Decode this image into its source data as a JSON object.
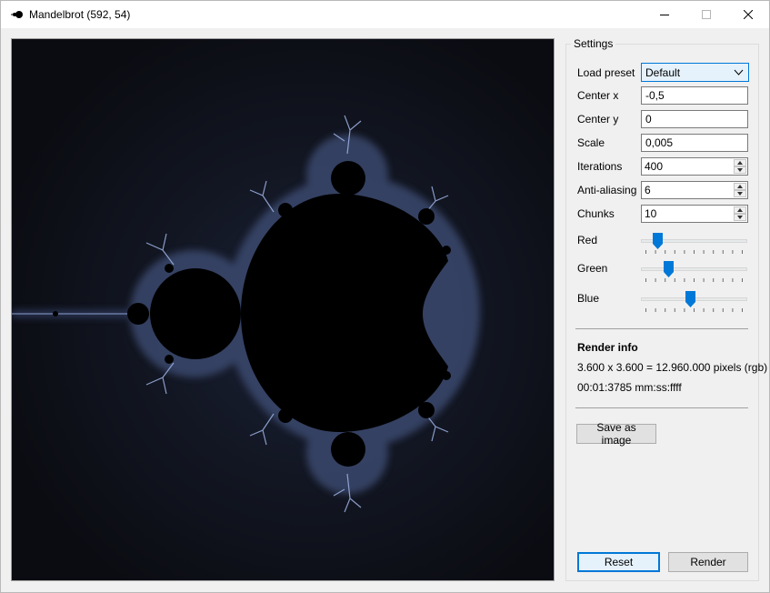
{
  "window": {
    "title": "Mandelbrot (592, 54)",
    "icon": "fractal-app-icon",
    "controls": [
      "minimize-icon",
      "maximize-icon",
      "close-icon"
    ]
  },
  "settings": {
    "legend": "Settings",
    "load_preset": {
      "label": "Load preset",
      "value": "Default"
    },
    "center_x": {
      "label": "Center x",
      "value": "-0,5"
    },
    "center_y": {
      "label": "Center y",
      "value": "0"
    },
    "scale": {
      "label": "Scale",
      "value": "0,005"
    },
    "iterations": {
      "label": "Iterations",
      "value": "400"
    },
    "anti_aliasing": {
      "label": "Anti-aliasing",
      "value": "6"
    },
    "chunks": {
      "label": "Chunks",
      "value": "10"
    },
    "sliders": [
      {
        "label": "Red",
        "level": 0.12
      },
      {
        "label": "Green",
        "level": 0.24
      },
      {
        "label": "Blue",
        "level": 0.46
      }
    ]
  },
  "render_info": {
    "heading": "Render info",
    "dimensions": "3.600 x 3.600 = 12.960.000 pixels (rgb)",
    "time": "00:01:3785 mm:ss:ffff"
  },
  "buttons": {
    "save": "Save as image",
    "reset": "Reset",
    "render": "Render"
  },
  "colors": {
    "background": "#0b0c12",
    "set": "#000000",
    "glow": "#9fb4e6",
    "accent": "#0078d7"
  }
}
